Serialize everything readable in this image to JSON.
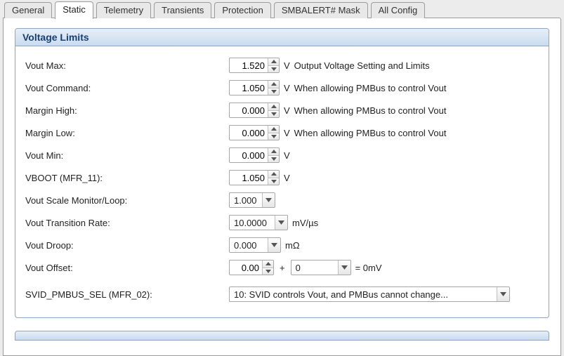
{
  "tabs": [
    "General",
    "Static",
    "Telemetry",
    "Transients",
    "Protection",
    "SMBALERT# Mask",
    "All Config"
  ],
  "activeTab": "Static",
  "group": {
    "title": "Voltage Limits",
    "rows": {
      "voutMax": {
        "label": "Vout Max:",
        "value": "1.520",
        "unit": "V",
        "desc": "Output Voltage Setting and Limits"
      },
      "voutCmd": {
        "label": "Vout Command:",
        "value": "1.050",
        "unit": "V",
        "desc": "When allowing PMBus to control Vout"
      },
      "marginHi": {
        "label": "Margin High:",
        "value": "0.000",
        "unit": "V",
        "desc": "When allowing PMBus to control Vout"
      },
      "marginLo": {
        "label": "Margin Low:",
        "value": "0.000",
        "unit": "V",
        "desc": "When allowing PMBus to control Vout"
      },
      "voutMin": {
        "label": "Vout Min:",
        "value": "0.000",
        "unit": "V"
      },
      "vboot": {
        "label": "VBOOT (MFR_11):",
        "value": "1.050",
        "unit": "V"
      },
      "scale": {
        "label": "Vout Scale Monitor/Loop:",
        "value": "1.000"
      },
      "trate": {
        "label": "Vout Transition Rate:",
        "value": "10.0000",
        "unit": "mV/µs"
      },
      "droop": {
        "label": "Vout Droop:",
        "value": "0.000",
        "unit": "mΩ"
      },
      "offset": {
        "label": "Vout Offset:",
        "a": "0.00",
        "plus": "+",
        "b": "0",
        "eq": "= 0mV"
      },
      "svid": {
        "label": "SVID_PMBUS_SEL (MFR_02):",
        "value": "10: SVID controls Vout, and PMBus cannot change..."
      }
    }
  }
}
